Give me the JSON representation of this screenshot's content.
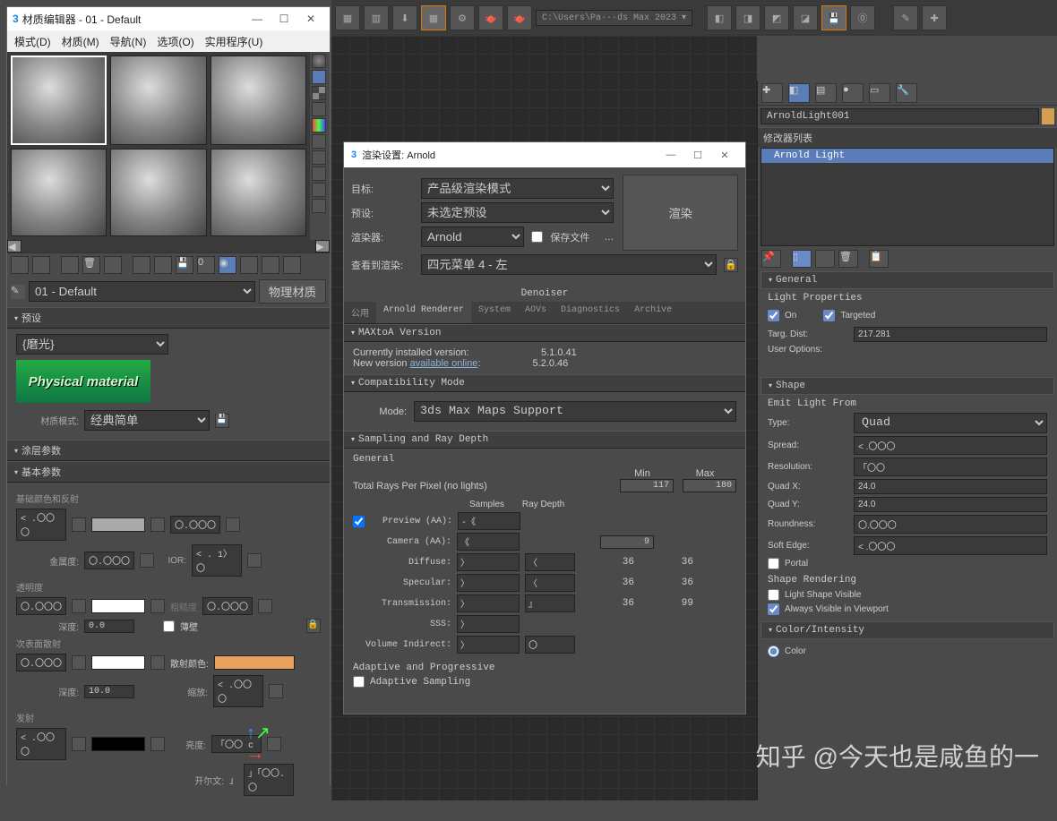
{
  "toolbar_top": {
    "path": "C:\\Users\\Pa···ds Max 2023 ▾"
  },
  "mat_editor": {
    "title": "材质编辑器 - 01 - Default",
    "menu": [
      "模式(D)",
      "材质(M)",
      "导航(N)",
      "选项(O)",
      "实用程序(U)"
    ],
    "current_name": "01 - Default",
    "phys_btn": "物理材质",
    "rollouts": {
      "preset_hdr": "预设",
      "preset_val": "{磨光}",
      "physmat_text": "Physical material",
      "mat_mode_label": "材质模式:",
      "mat_mode_val": "经典简单",
      "coating_hdr": "涂层参数",
      "basic_hdr": "基本参数",
      "base_color_label": "基础颜色和反射",
      "metalness_label": "金属度:",
      "ior_label": "IOR:",
      "opacity_label": "透明度",
      "depth_label": "深度:",
      "depth_val": "0.0",
      "thin_wall": "薄壁",
      "roughness_label": "粗糙度",
      "sss_label": "次表面散射",
      "scatter_color_label": "散射颜色:",
      "sss_depth": "10.0",
      "scale_label": "缩放:",
      "emission_label": "发射",
      "lum_label": "亮度:",
      "kelvin_label": "开尔文:",
      "spinner_vals": {
        "v1": "< .〇〇〇",
        "v2": "〇.〇〇〇",
        "v3": "< . 1〉〇",
        "v4": "〇.〇〇〇",
        "kelvin": "」「〇〇.〇"
      }
    }
  },
  "render_win": {
    "title": "渲染设置: Arnold",
    "target_label": "目标:",
    "target_val": "产品级渲染模式",
    "preset_label": "预设:",
    "preset_val": "未选定预设",
    "renderer_label": "渲染器:",
    "renderer_val": "Arnold",
    "save_file": "保存文件",
    "render_btn": "渲染",
    "view_label": "查看到渲染:",
    "view_val": "四元菜单 4 - 左",
    "denoiser_tab": "Denoiser",
    "tabs": [
      "公用",
      "Arnold Renderer",
      "System",
      "AOVs",
      "Diagnostics",
      "Archive"
    ],
    "version_hdr": "MAXtoA Version",
    "version_installed_lbl": "Currently installed version:",
    "version_installed": "5.1.0.41",
    "version_new_lbl": "New version",
    "version_new_link": "available online",
    "version_new": "5.2.0.46",
    "compat_hdr": "Compatibility Mode",
    "compat_mode_lbl": "Mode:",
    "compat_mode_val": "3ds Max Maps Support",
    "sampling_hdr": "Sampling and Ray Depth",
    "general_lbl": "General",
    "min_lbl": "Min",
    "max_lbl": "Max",
    "total_rays": "Total Rays Per Pixel (no lights)",
    "total_min": "117",
    "total_max": "180",
    "samples_lbl": "Samples",
    "raydepth_lbl": "Ray Depth",
    "rows": {
      "preview": {
        "lbl": "Preview (AA):",
        "samples": "-《"
      },
      "camera": {
        "lbl": "Camera (AA):",
        "samples": "《",
        "v1": "9"
      },
      "diffuse": {
        "lbl": "Diffuse:",
        "samples": "〉",
        "depth": "〈",
        "v1": "36",
        "v2": "36"
      },
      "specular": {
        "lbl": "Specular:",
        "samples": "〉",
        "depth": "〈",
        "v1": "36",
        "v2": "36"
      },
      "transmission": {
        "lbl": "Transmission:",
        "samples": "〉",
        "depth": "』",
        "v1": "36",
        "v2": "99"
      },
      "sss": {
        "lbl": "SSS:",
        "samples": "〉"
      },
      "volume": {
        "lbl": "Volume Indirect:",
        "samples": "〉",
        "depth": "〇"
      }
    },
    "adaptive_hdr": "Adaptive and Progressive",
    "adaptive_sampling": "Adaptive Sampling"
  },
  "right_panel": {
    "obj_name": "ArnoldLight001",
    "mod_list_label": "修改器列表",
    "mod_item": "Arnold Light",
    "general_hdr": "General",
    "light_props": "Light Properties",
    "on": "On",
    "targeted": "Targeted",
    "targ_dist_lbl": "Targ. Dist:",
    "targ_dist": "217.281",
    "user_opts": "User Options:",
    "shape_hdr": "Shape",
    "emit_from": "Emit Light From",
    "type_lbl": "Type:",
    "type_val": "Quad",
    "spread_lbl": "Spread:",
    "spread_val": "< .〇〇〇",
    "res_lbl": "Resolution:",
    "res_val": "「〇〇",
    "quadx_lbl": "Quad X:",
    "quadx": "24.0",
    "quady_lbl": "Quad Y:",
    "quady": "24.0",
    "round_lbl": "Roundness:",
    "round_val": "〇.〇〇〇",
    "softedge_lbl": "Soft Edge:",
    "softedge_val": "< .〇〇〇",
    "portal": "Portal",
    "shape_render": "Shape Rendering",
    "light_shape_vis": "Light Shape Visible",
    "always_vis": "Always Visible in Viewport",
    "color_intensity_hdr": "Color/Intensity",
    "color_radio": "Color"
  },
  "watermark": "知乎 @今天也是咸鱼的一"
}
